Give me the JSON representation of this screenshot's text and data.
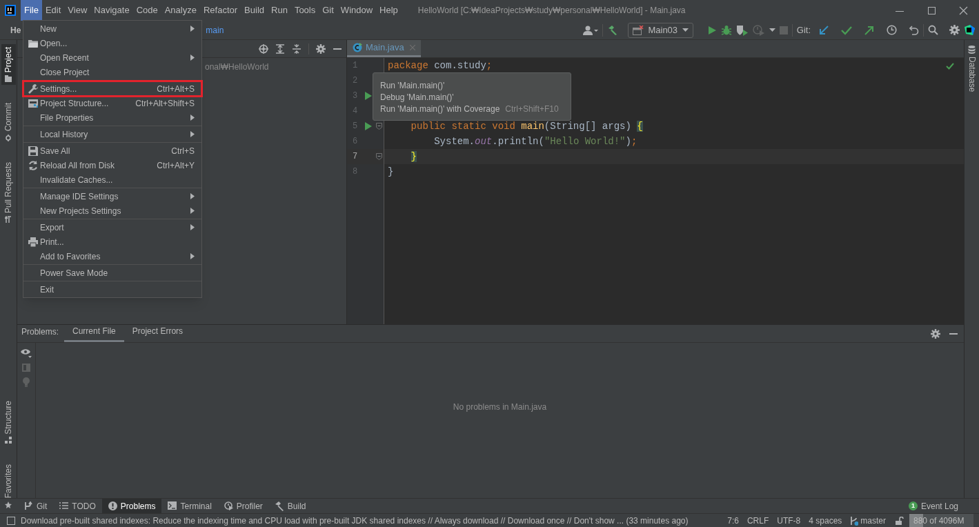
{
  "app_menu": [
    {
      "label": "File",
      "selected": true
    },
    {
      "label": "Edit",
      "selected": false
    },
    {
      "label": "View",
      "selected": false
    },
    {
      "label": "Navigate",
      "selected": false
    },
    {
      "label": "Code",
      "selected": false
    },
    {
      "label": "Analyze",
      "selected": false
    },
    {
      "label": "Refactor",
      "selected": false
    },
    {
      "label": "Build",
      "selected": false
    },
    {
      "label": "Run",
      "selected": false
    },
    {
      "label": "Tools",
      "selected": false
    },
    {
      "label": "Git",
      "selected": false
    },
    {
      "label": "Window",
      "selected": false
    },
    {
      "label": "Help",
      "selected": false
    }
  ],
  "window": {
    "title": "HelloWorld [C:₩IdeaProjects₩study₩personal₩HelloWorld] - Main.java"
  },
  "navigation_bar": {
    "breadcrumb_start": "He",
    "breadcrumb_end": "main"
  },
  "toolbar": {
    "run_configuration": "Main03",
    "git_label": "Git:"
  },
  "left_tool_strip": [
    {
      "label": "Project",
      "selected": true
    },
    {
      "label": "Commit",
      "selected": false
    },
    {
      "label": "Pull Requests",
      "selected": false
    },
    {
      "label": "Structure",
      "selected": false
    },
    {
      "label": "Favorites",
      "selected": false
    }
  ],
  "right_tool_strip": [
    {
      "label": "Database"
    }
  ],
  "project_panel": {
    "path_fragment": "onal₩HelloWorld"
  },
  "editor": {
    "tabs": [
      {
        "label": "Main.java",
        "selected": true
      }
    ],
    "lines": [
      {
        "number": "1",
        "current": false,
        "run": false,
        "fold": false,
        "tokens": [
          {
            "kind": "keyword",
            "text": "package"
          },
          {
            "kind": "plain",
            "text": " com.study"
          },
          {
            "kind": "keyword",
            "text": ";"
          }
        ]
      },
      {
        "number": "2",
        "current": false,
        "run": false,
        "fold": false
      },
      {
        "number": "3",
        "current": false,
        "run": true,
        "fold": false
      },
      {
        "number": "4",
        "current": false,
        "run": false,
        "fold": false
      },
      {
        "number": "5",
        "current": false,
        "run": true,
        "fold": true,
        "tokens": [
          {
            "kind": "keyword",
            "text": "    public static void "
          },
          {
            "kind": "method",
            "text": "main"
          },
          {
            "kind": "plain",
            "text": "(String[] args) "
          },
          {
            "kind": "brace",
            "text": "{"
          }
        ]
      },
      {
        "number": "6",
        "current": false,
        "run": false,
        "fold": false,
        "tokens": [
          {
            "kind": "plain",
            "text": "        System."
          },
          {
            "kind": "field",
            "text": "out"
          },
          {
            "kind": "plain",
            "text": ".println("
          },
          {
            "kind": "string",
            "text": "\"Hello World!\""
          },
          {
            "kind": "plain",
            "text": ")"
          },
          {
            "kind": "keyword",
            "text": ";"
          }
        ]
      },
      {
        "number": "7",
        "current": true,
        "run": false,
        "fold": true,
        "tokens": [
          {
            "kind": "brace",
            "text": "    }"
          }
        ]
      },
      {
        "number": "8",
        "current": false,
        "run": false,
        "fold": false,
        "tokens": [
          {
            "kind": "plain",
            "text": "}"
          }
        ]
      }
    ]
  },
  "run_popup": [
    {
      "label": "Run 'Main.main()'"
    },
    {
      "label": "Debug 'Main.main()'"
    },
    {
      "label": "Run 'Main.main()' with Coverage",
      "shortcut": "Ctrl+Shift+F10"
    }
  ],
  "file_menu": [
    [
      {
        "label": "New",
        "submenu": true
      },
      {
        "label": "Open..."
      },
      {
        "label": "Open Recent",
        "submenu": true
      },
      {
        "label": "Close Project"
      }
    ],
    [
      {
        "label": "Settings...",
        "shortcut": "Ctrl+Alt+S",
        "highlighted": true
      },
      {
        "label": "Project Structure...",
        "shortcut": "Ctrl+Alt+Shift+S"
      },
      {
        "label": "File Properties",
        "submenu": true
      }
    ],
    [
      {
        "label": "Local History",
        "submenu": true
      }
    ],
    [
      {
        "label": "Save All",
        "shortcut": "Ctrl+S"
      },
      {
        "label": "Reload All from Disk",
        "shortcut": "Ctrl+Alt+Y"
      },
      {
        "label": "Invalidate Caches..."
      }
    ],
    [
      {
        "label": "Manage IDE Settings",
        "submenu": true
      },
      {
        "label": "New Projects Settings",
        "submenu": true
      }
    ],
    [
      {
        "label": "Export",
        "submenu": true
      },
      {
        "label": "Print..."
      },
      {
        "label": "Add to Favorites",
        "submenu": true
      }
    ],
    [
      {
        "label": "Power Save Mode"
      }
    ],
    [
      {
        "label": "Exit"
      }
    ]
  ],
  "problems_panel": {
    "title": "Problems:",
    "tabs": [
      {
        "label": "Current File",
        "selected": true
      },
      {
        "label": "Project Errors",
        "selected": false
      }
    ],
    "empty_text": "No problems in Main.java"
  },
  "tool_window_bar": [
    {
      "label": "Git",
      "selected": false
    },
    {
      "label": "TODO",
      "selected": false
    },
    {
      "label": "Problems",
      "selected": true
    },
    {
      "label": "Terminal",
      "selected": false
    },
    {
      "label": "Profiler",
      "selected": false
    },
    {
      "label": "Build",
      "selected": false
    }
  ],
  "event_log": {
    "count": "1",
    "label": "Event Log"
  },
  "status_bar": {
    "message": "Download pre-built shared indexes: Reduce the indexing time and CPU load with pre-built JDK shared indexes // Always download // Download once // Don't show ... (33 minutes ago)",
    "position": "7:6",
    "line_separator": "CRLF",
    "encoding": "UTF-8",
    "indent": "4 spaces",
    "branch": "master",
    "memory": {
      "text": "880 of 4096M",
      "level": 0.21
    }
  }
}
